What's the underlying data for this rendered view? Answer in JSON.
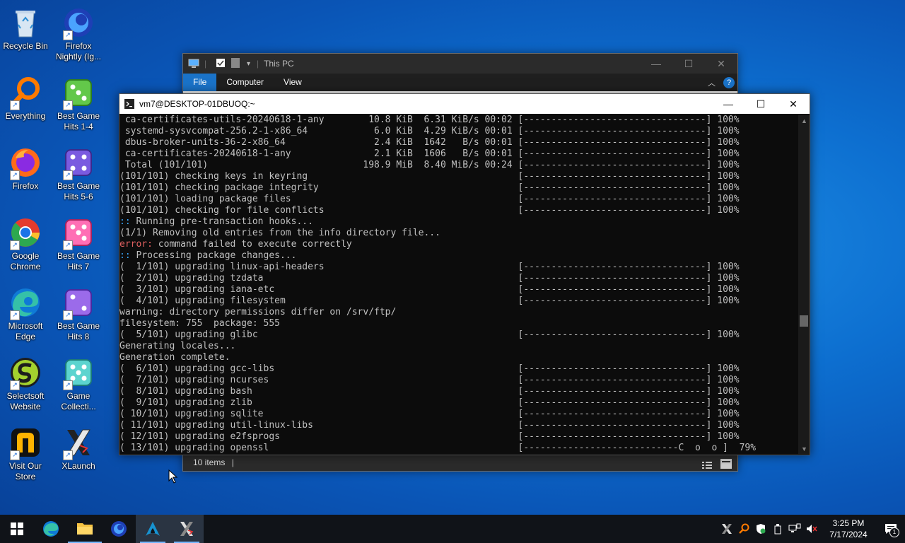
{
  "desktop": {
    "icons": [
      {
        "label": "Recycle Bin"
      },
      {
        "label": "Firefox Nightly (Ig..."
      },
      {
        "label": "Everything"
      },
      {
        "label": "Best Game Hits 1-4"
      },
      {
        "label": "Firefox"
      },
      {
        "label": "Best Game Hits 5-6"
      },
      {
        "label": "Google Chrome"
      },
      {
        "label": "Best Game Hits 7"
      },
      {
        "label": "Microsoft Edge"
      },
      {
        "label": "Best Game Hits 8"
      },
      {
        "label": "Selectsoft Website"
      },
      {
        "label": "Game Collecti..."
      },
      {
        "label": "Visit Our Store"
      },
      {
        "label": "XLaunch"
      }
    ]
  },
  "explorer": {
    "title": "This PC",
    "tabs": [
      "File",
      "Computer",
      "View"
    ],
    "status": "10 items"
  },
  "terminal": {
    "title": "vm7@DESKTOP-01DBUOQ:~",
    "lines": [
      " ca-certificates-utils-20240618-1-any        10.8 KiB  6.31 KiB/s 00:02 [---------------------------------] 100%",
      " systemd-sysvcompat-256.2-1-x86_64            6.0 KiB  4.29 KiB/s 00:01 [---------------------------------] 100%",
      " dbus-broker-units-36-2-x86_64                2.4 KiB  1642   B/s 00:01 [---------------------------------] 100%",
      " ca-certificates-20240618-1-any               2.1 KiB  1606   B/s 00:01 [---------------------------------] 100%",
      " Total (101/101)                            198.9 MiB  8.40 MiB/s 00:24 [---------------------------------] 100%",
      "(101/101) checking keys in keyring                                      [---------------------------------] 100%",
      "(101/101) checking package integrity                                    [---------------------------------] 100%",
      "(101/101) loading package files                                         [---------------------------------] 100%",
      "(101/101) checking for file conflicts                                   [---------------------------------] 100%",
      ":: Running pre-transaction hooks...",
      "(1/1) Removing old entries from the info directory file...",
      "error: command failed to execute correctly",
      ":: Processing package changes...",
      "(  1/101) upgrading linux-api-headers                                   [---------------------------------] 100%",
      "(  2/101) upgrading tzdata                                              [---------------------------------] 100%",
      "(  3/101) upgrading iana-etc                                            [---------------------------------] 100%",
      "(  4/101) upgrading filesystem                                          [---------------------------------] 100%",
      "warning: directory permissions differ on /srv/ftp/",
      "filesystem: 755  package: 555",
      "(  5/101) upgrading glibc                                               [---------------------------------] 100%",
      "Generating locales...",
      "Generation complete.",
      "(  6/101) upgrading gcc-libs                                            [---------------------------------] 100%",
      "(  7/101) upgrading ncurses                                             [---------------------------------] 100%",
      "(  8/101) upgrading bash                                                [---------------------------------] 100%",
      "(  9/101) upgrading zlib                                                [---------------------------------] 100%",
      "( 10/101) upgrading sqlite                                              [---------------------------------] 100%",
      "( 11/101) upgrading util-linux-libs                                     [---------------------------------] 100%",
      "( 12/101) upgrading e2fsprogs                                           [---------------------------------] 100%",
      "( 13/101) upgrading openssl                                             [----------------------------C  o  o ]  79%"
    ],
    "error_prefix": "error:",
    "hook_prefix": "::"
  },
  "taskbar": {
    "time": "3:25 PM",
    "date": "7/17/2024",
    "notification_count": "1"
  }
}
